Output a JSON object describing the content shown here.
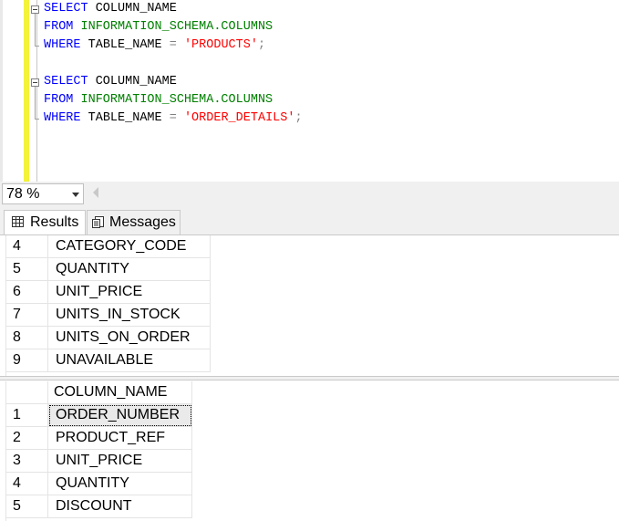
{
  "editor": {
    "query1": {
      "line1": {
        "select": "SELECT",
        "column": " COLUMN_NAME"
      },
      "line2": {
        "from": "FROM",
        "schema": " INFORMATION_SCHEMA.COLUMNS"
      },
      "line3": {
        "where": "WHERE",
        "field": " TABLE_NAME ",
        "eq": "=",
        "space": " ",
        "value": "'PRODUCTS'",
        "semicolon": ";"
      }
    },
    "query2": {
      "line1": {
        "select": "SELECT",
        "column": " COLUMN_NAME"
      },
      "line2": {
        "from": "FROM",
        "schema": " INFORMATION_SCHEMA.COLUMNS"
      },
      "line3": {
        "where": "WHERE",
        "field": " TABLE_NAME ",
        "eq": "=",
        "space": " ",
        "value": "'ORDER_DETAILS'",
        "semicolon": ";"
      }
    }
  },
  "zoom": {
    "value": "78 %"
  },
  "tabs": {
    "results": "Results",
    "messages": "Messages"
  },
  "grid1": {
    "rows": [
      {
        "n": "4",
        "v": "CATEGORY_CODE"
      },
      {
        "n": "5",
        "v": "QUANTITY"
      },
      {
        "n": "6",
        "v": "UNIT_PRICE"
      },
      {
        "n": "7",
        "v": "UNITS_IN_STOCK"
      },
      {
        "n": "8",
        "v": "UNITS_ON_ORDER"
      },
      {
        "n": "9",
        "v": "UNAVAILABLE"
      }
    ]
  },
  "grid2": {
    "header": "COLUMN_NAME",
    "rows": [
      {
        "n": "1",
        "v": "ORDER_NUMBER"
      },
      {
        "n": "2",
        "v": "PRODUCT_REF"
      },
      {
        "n": "3",
        "v": "UNIT_PRICE"
      },
      {
        "n": "4",
        "v": "QUANTITY"
      },
      {
        "n": "5",
        "v": "DISCOUNT"
      }
    ]
  }
}
